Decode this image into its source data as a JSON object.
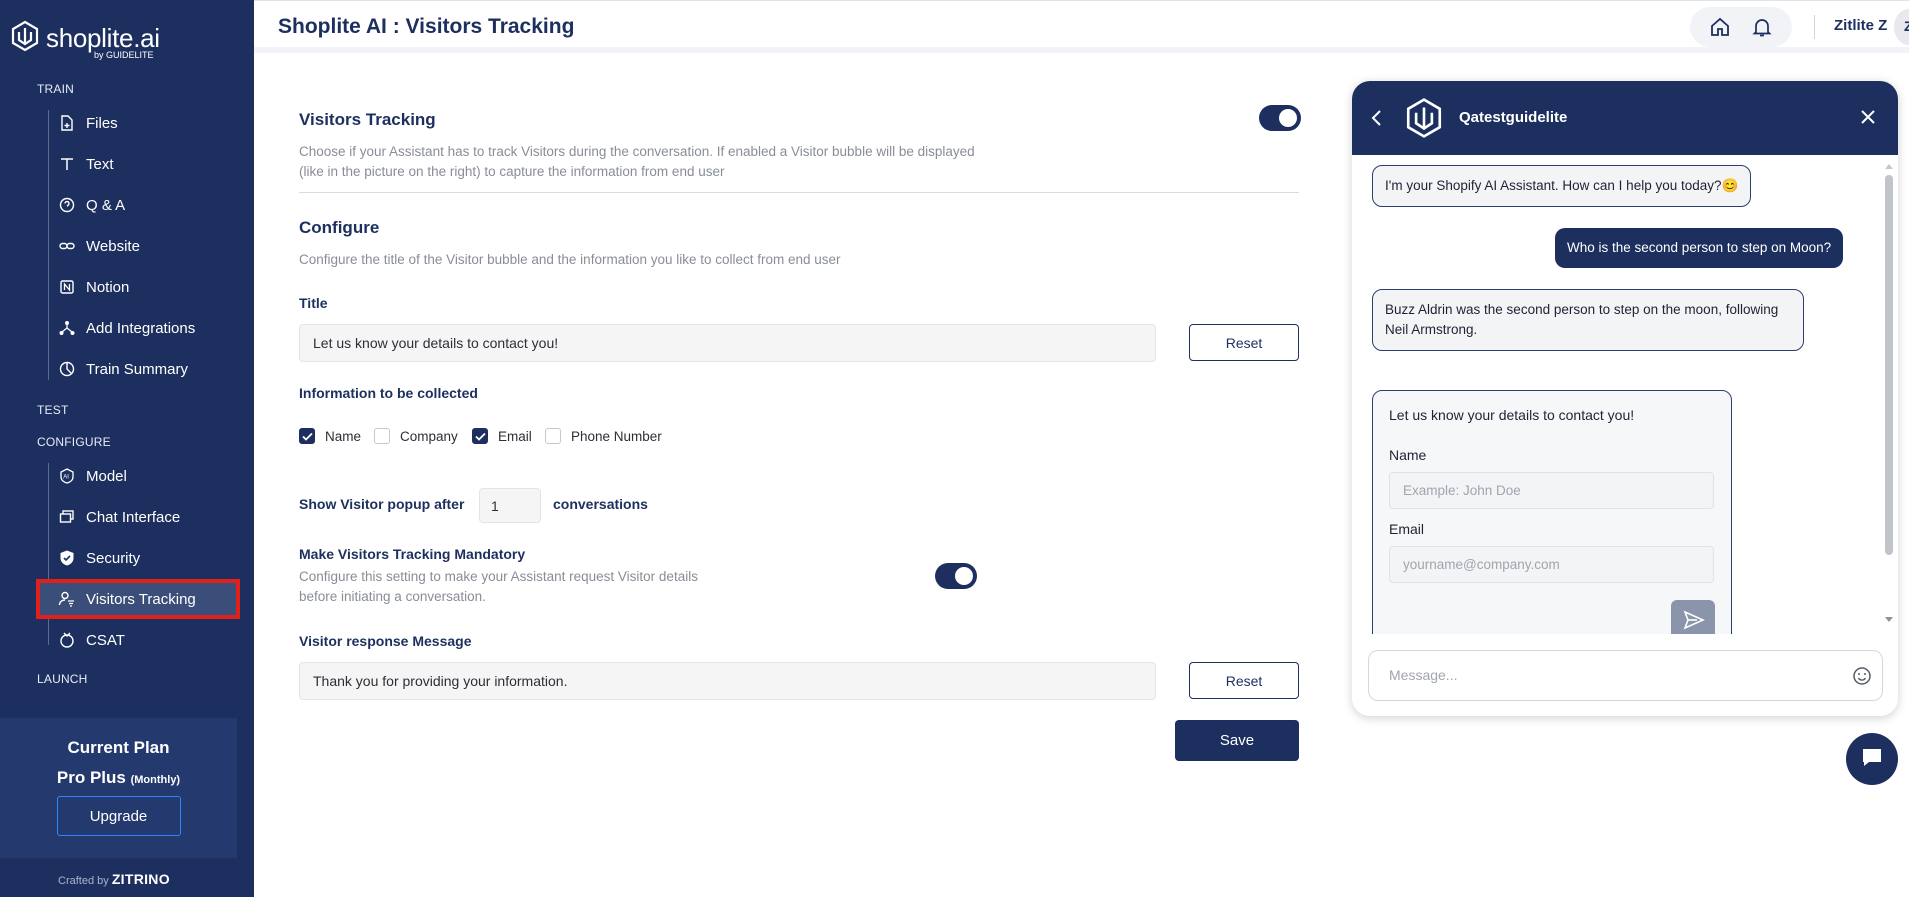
{
  "app": {
    "logo": "shoplite.ai",
    "logo_sub": "by GUIDELITE",
    "page_title": "Shoplite AI : Visitors Tracking",
    "user_name": "Zitlite Z",
    "avatar_initial": "Z"
  },
  "sidebar": {
    "sections": {
      "train": "TRAIN",
      "test": "TEST",
      "configure": "CONFIGURE",
      "launch": "LAUNCH"
    },
    "train_items": [
      {
        "label": "Files",
        "icon": "file-plus-icon"
      },
      {
        "label": "Text",
        "icon": "text-icon"
      },
      {
        "label": "Q & A",
        "icon": "chat-question-icon"
      },
      {
        "label": "Website",
        "icon": "link-icon"
      },
      {
        "label": "Notion",
        "icon": "notion-icon"
      },
      {
        "label": "Add Integrations",
        "icon": "integrations-icon"
      },
      {
        "label": "Train Summary",
        "icon": "summary-icon"
      }
    ],
    "configure_items": [
      {
        "label": "Model",
        "icon": "ai-model-icon"
      },
      {
        "label": "Chat Interface",
        "icon": "chat-window-icon"
      },
      {
        "label": "Security",
        "icon": "shield-icon"
      },
      {
        "label": "Visitors Tracking",
        "icon": "user-tracking-icon",
        "active": true
      },
      {
        "label": "CSAT",
        "icon": "csat-icon"
      }
    ],
    "plan": {
      "title": "Current Plan",
      "name": "Pro Plus",
      "cycle": "(Monthly)",
      "upgrade_label": "Upgrade"
    },
    "crafted_prefix": "Crafted by",
    "crafted_brand": "ZITRINO"
  },
  "settings": {
    "tracking_title": "Visitors Tracking",
    "tracking_desc": "Choose if your Assistant has to track Visitors during the conversation. If enabled a Visitor bubble will be displayed (like in the picture on the right) to capture the information from end user",
    "tracking_enabled": true,
    "configure_title": "Configure",
    "configure_desc": "Configure the title of the Visitor bubble and the information you like to collect from end user",
    "title_label": "Title",
    "title_value": "Let us know your details to contact you!",
    "reset_label": "Reset",
    "info_label": "Information to be collected",
    "fields": [
      {
        "label": "Name",
        "checked": true
      },
      {
        "label": "Company",
        "checked": false
      },
      {
        "label": "Email",
        "checked": true
      },
      {
        "label": "Phone Number",
        "checked": false
      }
    ],
    "popup_prefix": "Show Visitor popup after",
    "popup_value": "1",
    "popup_suffix": "conversations",
    "mandatory_title": "Make Visitors Tracking Mandatory",
    "mandatory_desc": "Configure this setting to make your Assistant request Visitor details before initiating a conversation.",
    "mandatory_enabled": true,
    "response_label": "Visitor response Message",
    "response_value": "Thank you for providing your information.",
    "save_label": "Save"
  },
  "chat": {
    "bot_name": "Qatestguidelite",
    "messages": [
      {
        "from": "bot",
        "text": "I'm your Shopify AI Assistant. How can I help you today?😊"
      },
      {
        "from": "user",
        "text": "Who is the second person to step on Moon?"
      },
      {
        "from": "bot",
        "text": "Buzz Aldrin was the second person to step on the moon, following Neil Armstrong."
      }
    ],
    "form": {
      "title": "Let us know your details to contact you!",
      "name_label": "Name",
      "name_placeholder": "Example: John Doe",
      "email_label": "Email",
      "email_placeholder": "yourname@company.com"
    },
    "message_placeholder": "Message..."
  },
  "colors": {
    "primary": "#1c2f5e",
    "highlight": "#e0201b"
  }
}
